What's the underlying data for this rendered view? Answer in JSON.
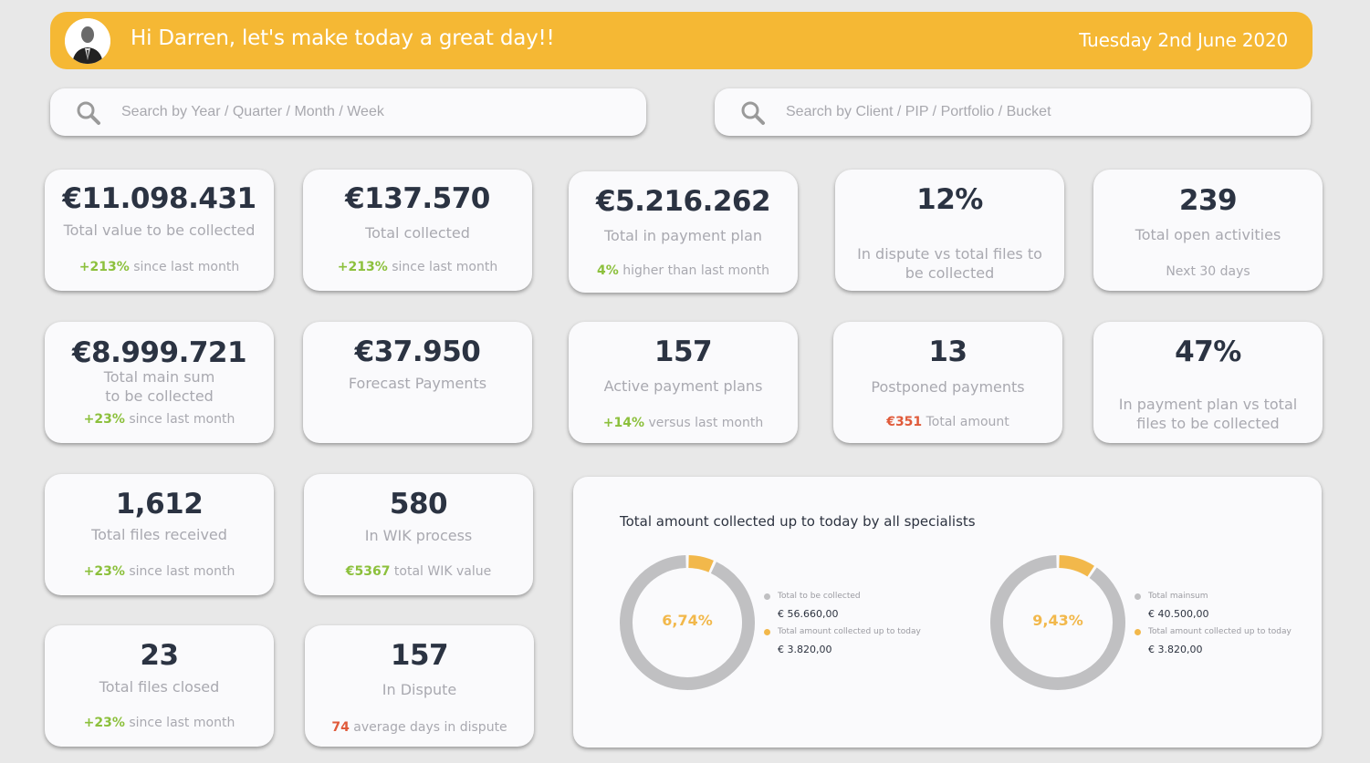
{
  "header": {
    "greeting": "Hi Darren, let's make today a great day!!",
    "date": "Tuesday 2nd June 2020",
    "accent_color": "#f5b834"
  },
  "search": {
    "period_placeholder": "Search by Year / Quarter / Month / Week",
    "period_value": "",
    "client_placeholder": "Search by Client / PIP / Portfolio / Bucket",
    "client_value": "",
    "icon": "search-icon"
  },
  "cards": [
    {
      "value": "€11.098.431",
      "label": "Total value to be collected",
      "foot_highlight": "+213%",
      "foot_text": " since last month",
      "foot_color": "green"
    },
    {
      "value": "€137.570",
      "label": "Total collected",
      "foot_highlight": "+213%",
      "foot_text": " since last month",
      "foot_color": "green"
    },
    {
      "value": "€5.216.262",
      "label": "Total in payment plan",
      "foot_highlight": "4%",
      "foot_text": " higher than last month",
      "foot_color": "green"
    },
    {
      "value": "12%",
      "label": "In dispute vs total files to be collected",
      "foot_highlight": "",
      "foot_text": ""
    },
    {
      "value": "239",
      "label": "Total open activities",
      "foot_highlight": "",
      "foot_text": "Next 30 days"
    },
    {
      "value": "€8.999.721",
      "label": "Total main sum to be collected",
      "foot_highlight": "+23%",
      "foot_text": " since last month",
      "foot_color": "green"
    },
    {
      "value": "€37.950",
      "label": "Forecast Payments",
      "foot_highlight": "",
      "foot_text": ""
    },
    {
      "value": "157",
      "label": "Active payment plans",
      "foot_highlight": "+14%",
      "foot_text": " versus last month",
      "foot_color": "green"
    },
    {
      "value": "13",
      "label": "Postponed payments",
      "foot_highlight": "€351",
      "foot_text": " Total amount",
      "foot_color": "red"
    },
    {
      "value": "47%",
      "label": "In payment plan vs total files to be collected",
      "foot_highlight": "",
      "foot_text": ""
    },
    {
      "value": "1,612",
      "label": "Total files received",
      "foot_highlight": "+23%",
      "foot_text": " since last month",
      "foot_color": "green"
    },
    {
      "value": "580",
      "label": "In WIK process",
      "foot_highlight": "€5367",
      "foot_text": " total WIK value",
      "foot_color": "green"
    },
    {
      "value": "23",
      "label": "Total files closed",
      "foot_highlight": "+23%",
      "foot_text": " since last month",
      "foot_color": "green"
    },
    {
      "value": "157",
      "label": "In Dispute",
      "foot_highlight": "74",
      "foot_text": " average days in dispute",
      "foot_color": "red"
    }
  ],
  "chart_panel": {
    "title": "Total amount collected up to today by all specialists"
  },
  "chart_data": [
    {
      "type": "pie",
      "center_label": "6,74%",
      "labels": [
        "Total to be collected",
        "Total amount collected up to today"
      ],
      "values": [
        56660.0,
        3820.0
      ],
      "value_labels": [
        "€ 56.660,00",
        "€ 3.820,00"
      ],
      "colors": [
        "#c0c0c2",
        "#f2b84b"
      ],
      "collected_fraction": 0.0674
    },
    {
      "type": "pie",
      "center_label": "9,43%",
      "labels": [
        "Total mainsum",
        "Total amount collected up to today"
      ],
      "values": [
        40500.0,
        3820.0
      ],
      "value_labels": [
        "€ 40.500,00",
        "€ 3.820,00"
      ],
      "colors": [
        "#c0c0c2",
        "#f2b84b"
      ],
      "collected_fraction": 0.0943
    }
  ]
}
